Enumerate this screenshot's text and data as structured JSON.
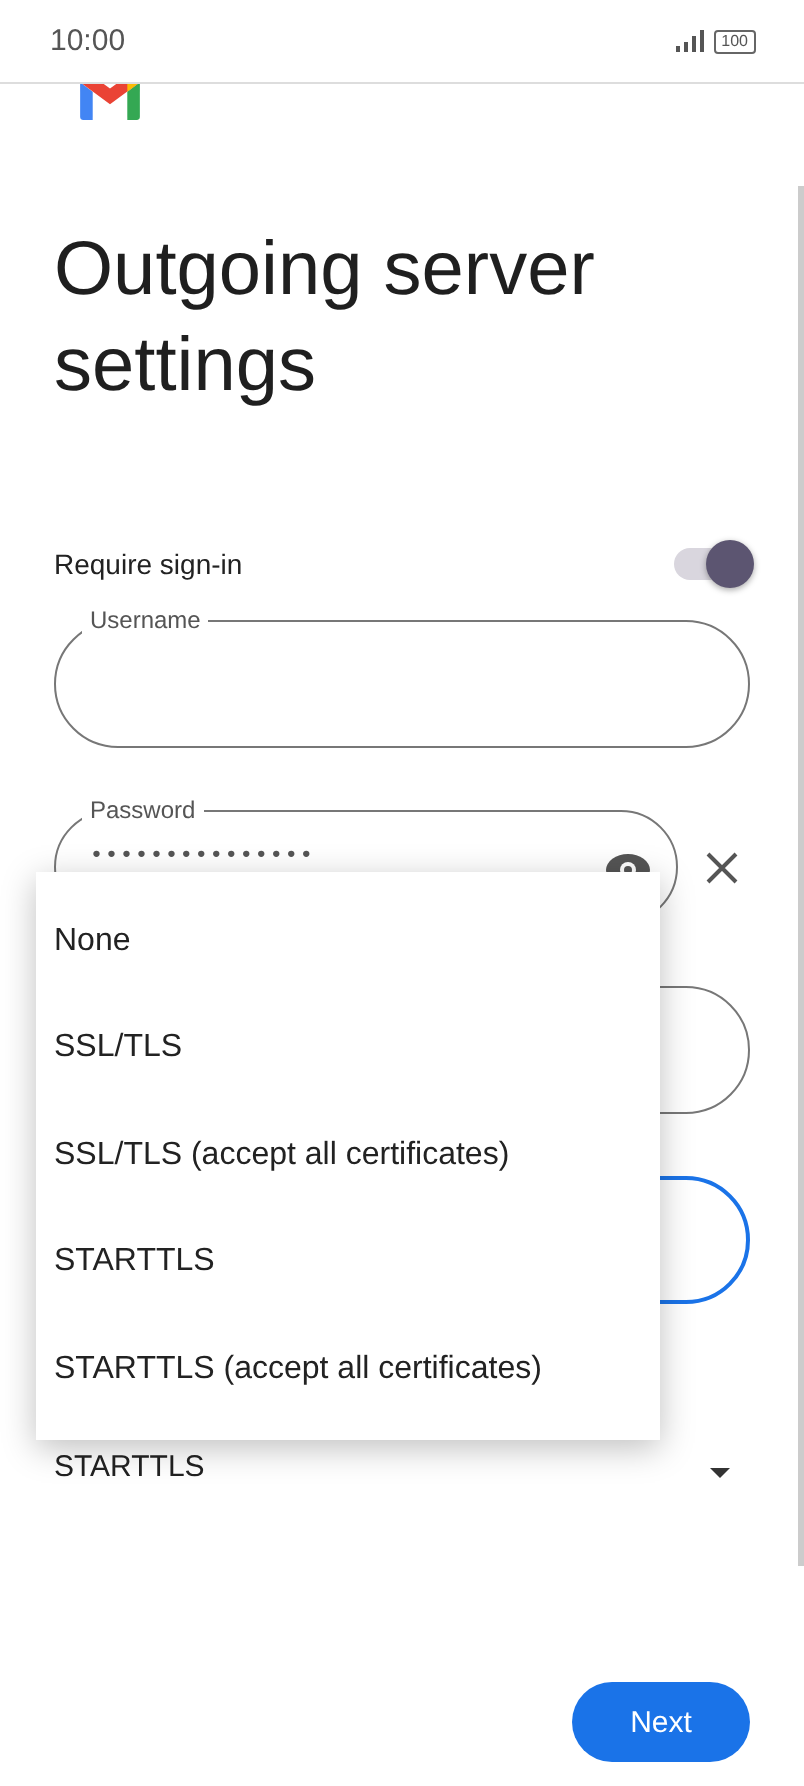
{
  "status_bar": {
    "time": "10:00",
    "battery": "100"
  },
  "title": "Outgoing server settings",
  "require_sign_in": {
    "label": "Require sign-in",
    "on": true
  },
  "fields": [
    {
      "kind": "text",
      "label": "Username",
      "focused": false
    },
    {
      "kind": "password",
      "label": "Password",
      "value": "•••••••••••••••",
      "focused": false
    },
    {
      "kind": "text",
      "focused": false
    },
    {
      "kind": "text",
      "focused": true
    }
  ],
  "security": {
    "value": "STARTTLS"
  },
  "menu": {
    "items": [
      {
        "label": "None"
      },
      {
        "label": "SSL/TLS"
      },
      {
        "label": "SSL/TLS (accept all certificates)"
      },
      {
        "label": "STARTTLS"
      },
      {
        "label": "STARTTLS (accept all certificates)"
      }
    ]
  },
  "next_button": "Next"
}
